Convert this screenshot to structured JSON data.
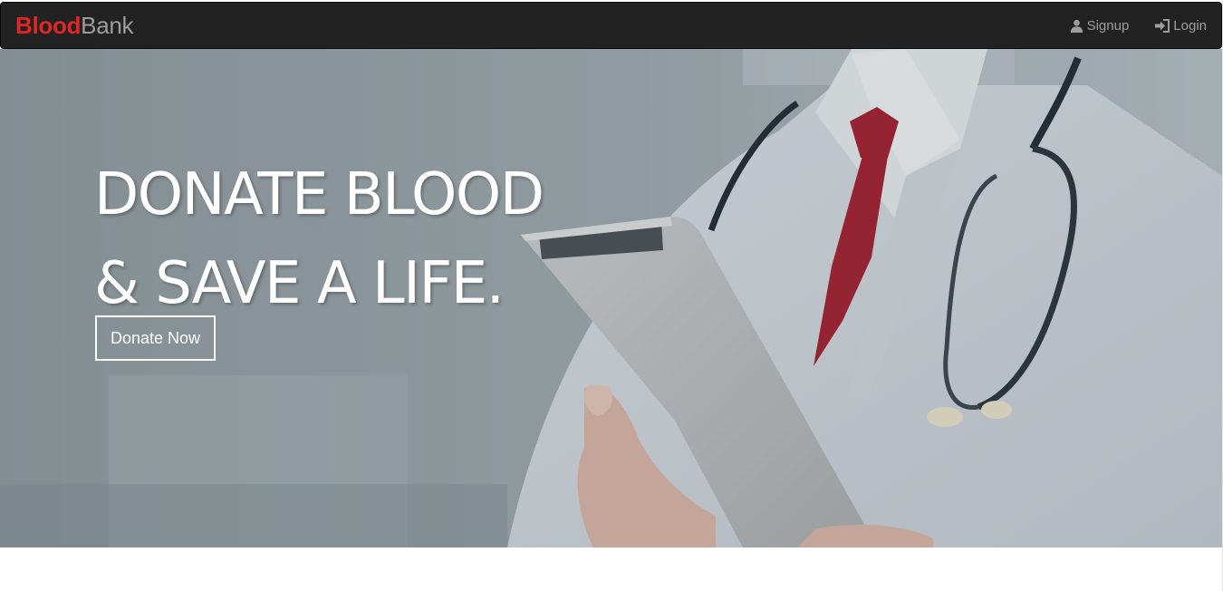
{
  "navbar": {
    "brand_part1": "Blood",
    "brand_part2": "Bank",
    "links": [
      {
        "label": "Signup",
        "icon": "user-icon"
      },
      {
        "label": "Login",
        "icon": "login-icon"
      }
    ]
  },
  "hero": {
    "title_line1": "DONATE BLOOD",
    "title_line2": "& SAVE A LIFE.",
    "cta_label": "Donate Now"
  },
  "colors": {
    "navbar_bg": "#222222",
    "brand_accent": "#e22626",
    "nav_text": "#9d9d9d",
    "tie": "#a21f2e"
  }
}
